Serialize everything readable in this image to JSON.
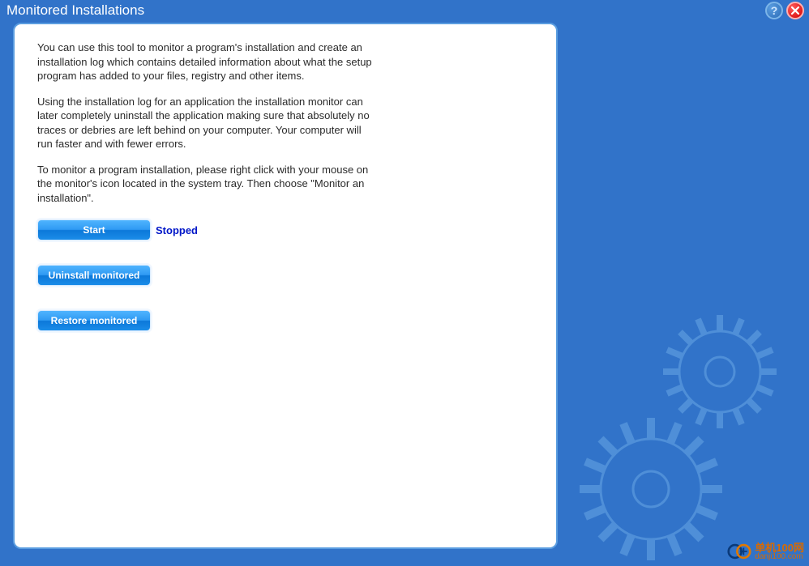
{
  "header": {
    "title": "Monitored Installations",
    "help_label": "?",
    "close_label": "×"
  },
  "content": {
    "para1": "You can use this tool to monitor a program's installation and create an installation log which contains detailed information about what the setup program has added to your files, registry and other items.",
    "para2": "Using the installation log for an application the installation monitor can later completely uninstall the application making sure that absolutely no traces or debries are left behind on your computer. Your computer will run faster and with fewer errors.",
    "para3": "To monitor a program installation, please right click with your mouse on the monitor's icon located in the system tray. Then choose \"Monitor an installation\"."
  },
  "buttons": {
    "start": "Start",
    "status": "Stopped",
    "uninstall": "Uninstall monitored",
    "restore": "Restore monitored"
  },
  "watermark": {
    "line1": "单机100网",
    "line2": "danji100.com"
  },
  "colors": {
    "background": "#3173c9",
    "accent": "#0c78d9",
    "status_text": "#0016c8"
  }
}
